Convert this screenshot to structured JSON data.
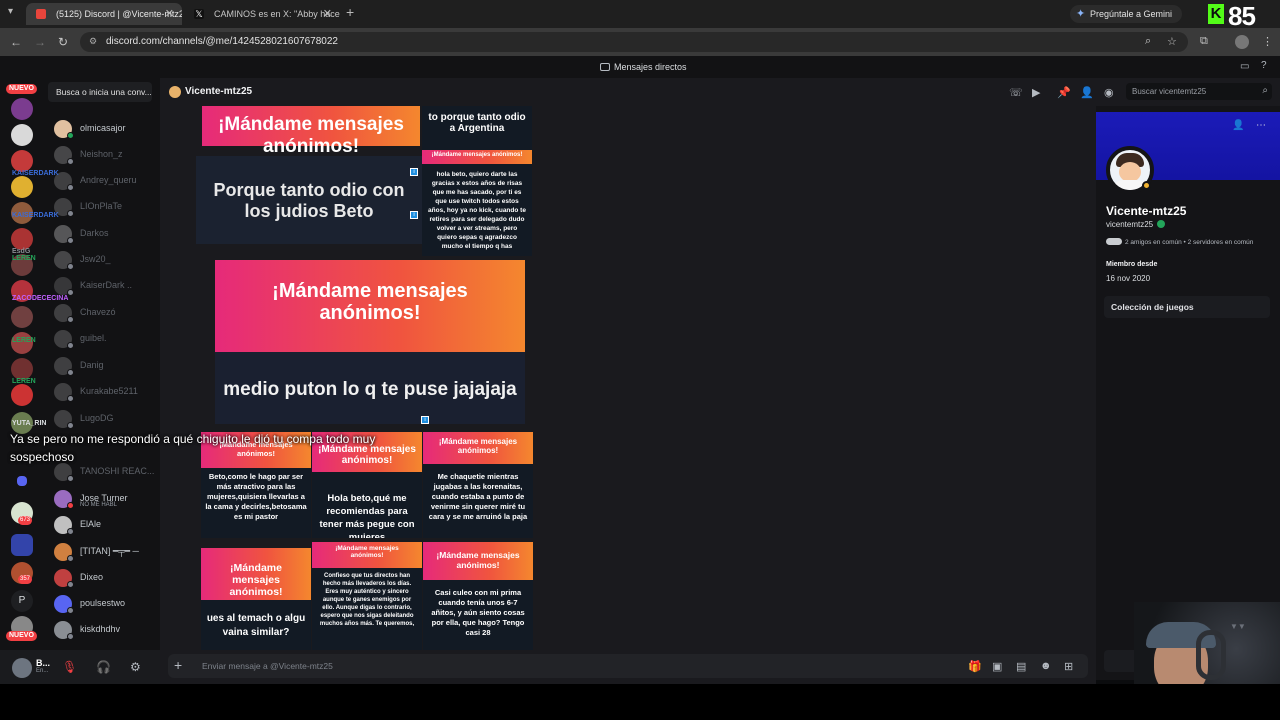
{
  "browser": {
    "tabs": [
      {
        "title": "(5125) Discord | @Vicente-mtz25",
        "active": true
      },
      {
        "title": "CAMINOS es en X: \"Abby hace",
        "active": false
      }
    ],
    "url": "discord.com/channels/@me/1424528021607678022",
    "gemini_label": "Pregúntale a Gemini"
  },
  "stream_overlay": {
    "viewers": "85",
    "platform_letter": "K"
  },
  "discord": {
    "top_title": "Mensajes directos",
    "rail": {
      "new_badge_top": "NUEVO",
      "new_badge_bottom": "NUEVO",
      "badges": [
        "673",
        "357"
      ],
      "letter_server": "P"
    },
    "dm_search_placeholder": "Busca o inicia una conv...",
    "dms": [
      {
        "name": "olmicasajor",
        "dim": false,
        "color": "#e0c0a0",
        "status": "#23a55a"
      },
      {
        "name": "Neishon_z",
        "dim": true,
        "color": "#888",
        "status": "#80848e"
      },
      {
        "name": "Andrey_queru",
        "dim": true,
        "color": "#777",
        "status": "#80848e"
      },
      {
        "name": "LIOnPlaTe",
        "dim": true,
        "color": "#777",
        "status": "#80848e"
      },
      {
        "name": "Darkos",
        "dim": true,
        "color": "#aaa",
        "status": "#80848e"
      },
      {
        "name": "Jsw20_",
        "dim": true,
        "color": "#888",
        "status": "#80848e"
      },
      {
        "name": "KaiserDark ..",
        "dim": true,
        "color": "#666",
        "status": "#80848e"
      },
      {
        "name": "Chavezó",
        "dim": true,
        "color": "#777",
        "status": "#80848e"
      },
      {
        "name": "guibel.",
        "dim": true,
        "color": "#777",
        "status": "#80848e"
      },
      {
        "name": "Danig",
        "dim": true,
        "color": "#777",
        "status": "#80848e"
      },
      {
        "name": "Kurakabe5211",
        "dim": true,
        "color": "#777",
        "status": "#80848e"
      },
      {
        "name": "LugoDG",
        "dim": true,
        "color": "#777",
        "status": "#80848e"
      },
      {
        "name": "TANOSHI REAC...",
        "dim": true,
        "color": "#777",
        "status": "#80848e"
      },
      {
        "name": "Jose Turner",
        "sub": "NO ME HABL",
        "dim": false,
        "color": "#9a6cc0",
        "status": "#f23f43"
      },
      {
        "name": "ElAle",
        "dim": false,
        "color": "#c0c0c0",
        "status": "#80848e"
      },
      {
        "name": "[TITAN] ━╤━ ─",
        "dim": false,
        "color": "#d08040",
        "status": "#80848e"
      },
      {
        "name": "Dixeo",
        "dim": false,
        "color": "#c04040",
        "status": "#80848e"
      },
      {
        "name": "poulsestwo",
        "dim": false,
        "color": "#5865f2",
        "status": "#80848e"
      },
      {
        "name": "kiskdhdhv",
        "dim": false,
        "color": "#8a8e94",
        "status": "#80848e"
      }
    ],
    "user_panel": {
      "name": "B...",
      "status": "En..."
    },
    "chat": {
      "recipient": "Vicente-mtz25",
      "search_placeholder": "Buscar vicentemtz25",
      "composer_placeholder": "Enviar mensaje a @Vicente-mtz25"
    },
    "profile": {
      "display_name": "Vicente-mtz25",
      "username": "vicentemtz25",
      "mutual": "2 amigos en común • 2 servidores en común",
      "member_since_label": "Miembro desde",
      "member_since": "16 nov 2020",
      "games_label": "Colección de juegos",
      "view_button": "Ver"
    }
  },
  "collage": {
    "banner_text": "¡Mándame mensajes anónimos!",
    "small_banner_text": "¡Mándame mensajes anónimos!",
    "c1_banner": "¡Mándame mensajes anónimos!",
    "c2_banner": "to porque tanto odio a Argentina",
    "c2_body": "hola beto, quiero darte las gracias x estos años de risas que me has sacado, por ti es que use twitch todos estos años, hoy ya no kick, cuando te retires para ser delegado dudo volver a ver streams, pero quiero sepas q agradezco mucho el tiempo q has",
    "c3_body": "Porque tanto odio con los judios Beto",
    "c4_body": "medio puton lo q te puse jajajaja",
    "c5_body": "Beto,como le hago par ser más atractivo para las mujeres,quisiera llevarlas a la cama y decirles,betosama es mi pastor",
    "c6_body": "Hola beto,qué me recomiendas para tener más pegue con mujeres",
    "c7_body": "Me chaquetie mientras jugabas a las korenaitas, cuando estaba a punto de venirme sin querer miré tu cara y se me arruinó la paja",
    "c8_body": "ues al temach o algu vaina similar?",
    "c9_body": "Confieso que tus directos han hecho más llevaderos los días. Eres muy auténtico y sincero aunque te ganes enemigos por ello. Aunque digas lo contrario, espero que nos sigas deleitando muchos años más. Te queremos,",
    "c10_body": "Casi culeo con mi prima cuando tenía unos 6-7 añitos, y aún siento cosas por ella, que hago? Tengo casi 28",
    "side_labels": [
      "KAISERDARK",
      "KAISERDARK",
      "EsdG",
      "LEREN",
      "ZACODECECINA",
      "LEREN",
      "LEREN",
      "YUTA_RIN"
    ],
    "caption": "Ya se pero no me respondió a qué chiguito le dió tu compa todo muy sospechoso"
  }
}
